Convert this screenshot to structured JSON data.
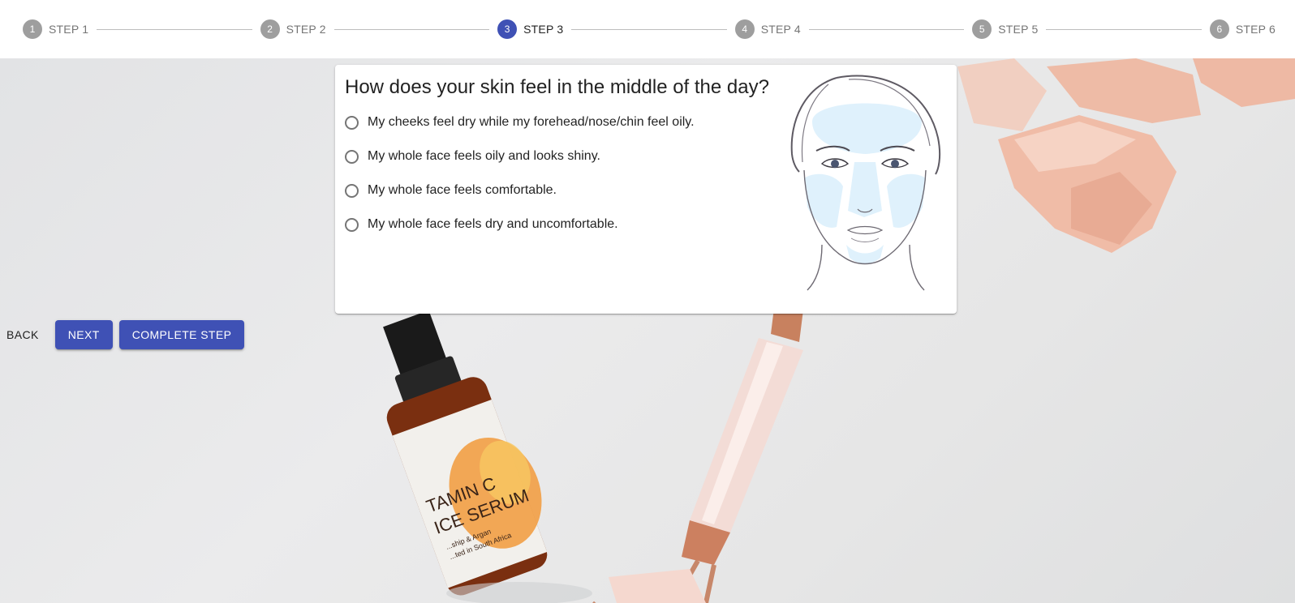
{
  "stepper": {
    "active_index": 2,
    "steps": [
      {
        "number": "1",
        "label": "STEP 1"
      },
      {
        "number": "2",
        "label": "STEP 2"
      },
      {
        "number": "3",
        "label": "STEP 3"
      },
      {
        "number": "4",
        "label": "STEP 4"
      },
      {
        "number": "5",
        "label": "STEP 5"
      },
      {
        "number": "6",
        "label": "STEP 6"
      }
    ]
  },
  "question": {
    "title": "How does your skin feel in the middle of the day?",
    "options": [
      {
        "label": "My cheeks feel dry while my forehead/nose/chin feel oily.",
        "selected": false
      },
      {
        "label": "My whole face feels oily and looks shiny.",
        "selected": false
      },
      {
        "label": "My whole face feels comfortable.",
        "selected": false
      },
      {
        "label": "My whole face feels dry and uncomfortable.",
        "selected": false
      }
    ],
    "illustration": "face-zones-illustration"
  },
  "actions": {
    "back_label": "BACK",
    "next_label": "NEXT",
    "complete_label": "COMPLETE STEP"
  },
  "background": {
    "serum_text_1": "TAMIN C",
    "serum_text_2": "ICE SERUM",
    "serum_small_1": "...ship & Argan",
    "serum_small_2": "...ted in South Africa"
  },
  "colors": {
    "primary": "#3f51b5",
    "inactive_step": "#9e9e9e",
    "face_zone": "#dff1fc"
  }
}
